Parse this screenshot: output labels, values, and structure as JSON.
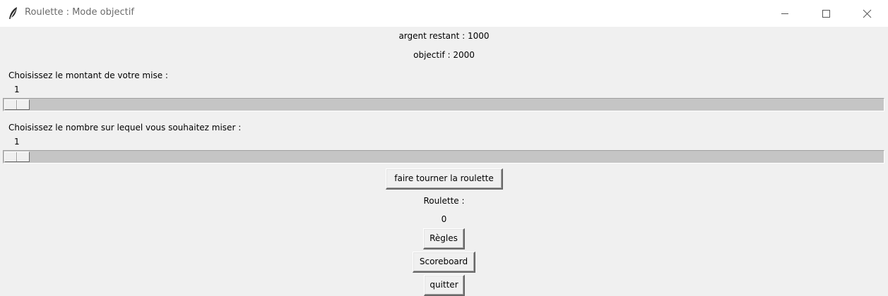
{
  "window": {
    "title": "Roulette : Mode objectif",
    "icon": "feather-icon",
    "controls": [
      "minimize-icon",
      "maximize-icon",
      "close-icon"
    ]
  },
  "status": {
    "money_left": "argent restant : 1000",
    "objective": "objectif : 2000"
  },
  "bet_amount": {
    "label": "Choisissez le montant de votre mise :",
    "value": "1",
    "slider_fraction": 0
  },
  "bet_number": {
    "label": "Choisissez le nombre sur lequel vous souhaitez miser :",
    "value": "1",
    "slider_fraction": 0
  },
  "buttons": {
    "spin": "faire tourner la roulette",
    "rules": "Règles",
    "scoreboard": "Scoreboard",
    "quit": "quitter"
  },
  "roulette": {
    "label": "Roulette :",
    "result": "0"
  }
}
